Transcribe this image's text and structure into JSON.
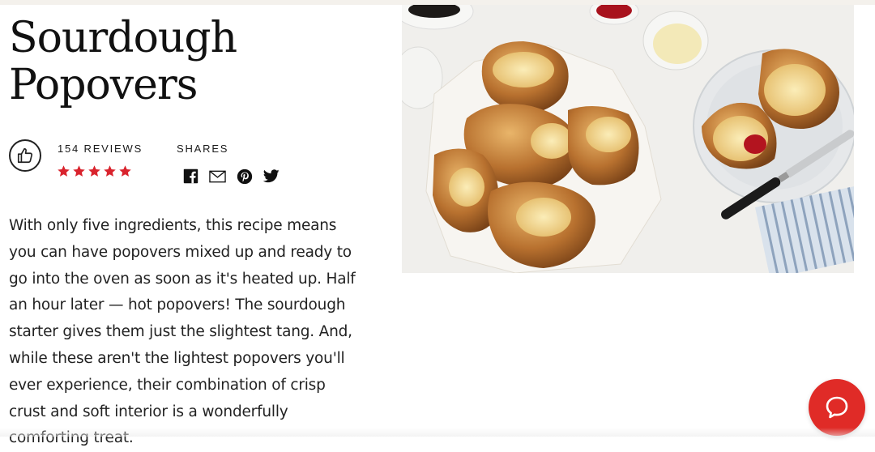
{
  "recipe": {
    "title_line1": "Sourdough",
    "title_line2": "Popovers",
    "reviews_label": "154 REVIEWS",
    "rating": 5,
    "rating_max": 5,
    "shares_label": "SHARES",
    "description": "With only five ingredients, this recipe means you can have popovers mixed up and ready to go into the oven as soon as it's heated up. Half an hour later — hot popovers! The sourdough starter gives them just the slightest tang. And, while these aren't the lightest popovers you'll ever experience, their combination of crisp crust and soft interior is a wonderfully comforting treat."
  },
  "share_icons": [
    "facebook-icon",
    "email-icon",
    "pinterest-icon",
    "twitter-icon"
  ],
  "icons": {
    "like": "thumbs-up-icon",
    "chat": "chat-bubble-icon"
  },
  "colors": {
    "star": "#d9232d",
    "chat_button": "#e02b27",
    "text": "#1a1a1a"
  }
}
